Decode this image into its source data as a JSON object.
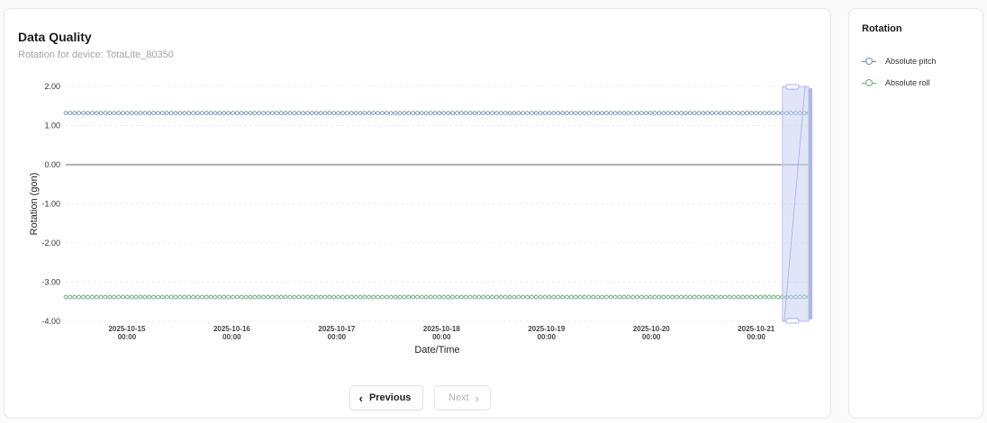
{
  "header": {
    "title": "Data Quality",
    "subtitle": "Rotation for device: TotaLite_80350"
  },
  "legend": {
    "title": "Rotation",
    "items": [
      {
        "label": "Absolute pitch",
        "color": "#6f91b3"
      },
      {
        "label": "Absolute roll",
        "color": "#6aa97f"
      }
    ]
  },
  "pagination": {
    "prev_label": "Previous",
    "next_label": "Next",
    "prev_icon": "chevron-left-icon",
    "next_icon": "chevron-right-icon",
    "next_disabled": true
  },
  "chart_data": {
    "type": "line",
    "xlabel": "Date/Time",
    "ylabel": "Rotation (gon)",
    "ylim": [
      -4.0,
      2.0
    ],
    "yticks": [
      "2.00",
      "1.00",
      "0.00",
      "-1.00",
      "-2.00",
      "-3.00",
      "-4.00"
    ],
    "xticks": [
      {
        "date": "2025-10-15",
        "time": "00:00"
      },
      {
        "date": "2025-10-16",
        "time": "00:00"
      },
      {
        "date": "2025-10-17",
        "time": "00:00"
      },
      {
        "date": "2025-10-18",
        "time": "00:00"
      },
      {
        "date": "2025-10-19",
        "time": "00:00"
      },
      {
        "date": "2025-10-20",
        "time": "00:00"
      },
      {
        "date": "2025-10-21",
        "time": "00:00"
      }
    ],
    "xlim": [
      "2025-10-14 10:00",
      "2025-10-21 12:00"
    ],
    "grid": true,
    "series": [
      {
        "name": "Absolute pitch",
        "value": 1.32,
        "color": "#6f91b3",
        "x_start": "2025-10-14 10:00",
        "x_end": "2025-10-21 12:00",
        "samples": 170
      },
      {
        "name": "Absolute roll",
        "value": -3.38,
        "color": "#6aa97f",
        "x_start": "2025-10-14 10:00",
        "x_end": "2025-10-21 12:00",
        "samples": 170
      }
    ],
    "highlight": {
      "x_start": "2025-10-21 06:00",
      "x_end": "2025-10-21 12:00",
      "color": "#c9cff2"
    }
  }
}
